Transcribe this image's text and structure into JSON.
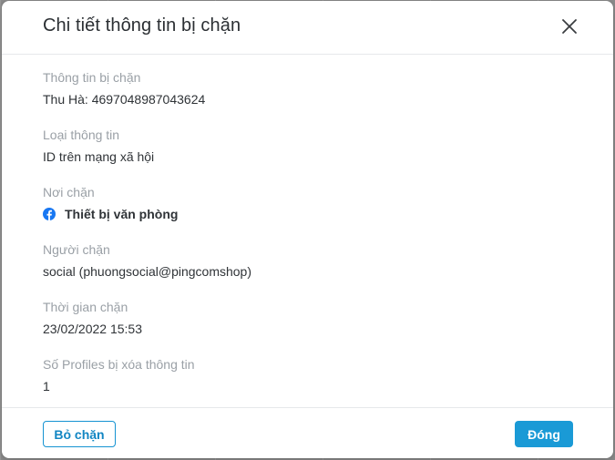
{
  "dialog": {
    "title": "Chi tiết thông tin bị chặn",
    "close_icon": "close-icon"
  },
  "fields": {
    "blocked_info": {
      "label": "Thông tin bị chặn",
      "value": "Thu Hà: 4697048987043624"
    },
    "info_type": {
      "label": "Loại thông tin",
      "value": "ID trên mạng xã hội"
    },
    "block_source": {
      "label": "Nơi chặn",
      "value": "Thiết bị văn phòng",
      "icon": "facebook-icon",
      "icon_color": "#1877f2"
    },
    "blocked_by": {
      "label": "Người chặn",
      "value": "social (phuongsocial@pingcomshop)"
    },
    "block_time": {
      "label": "Thời gian chặn",
      "value": "23/02/2022 15:53"
    },
    "profiles_cleared": {
      "label": "Số Profiles bị xóa thông tin",
      "value": "1"
    }
  },
  "footer": {
    "unblock_label": "Bỏ chặn",
    "close_label": "Đóng"
  },
  "colors": {
    "accent": "#1a9ad6",
    "label_gray": "#9aa0a6",
    "text": "#2f3337"
  }
}
